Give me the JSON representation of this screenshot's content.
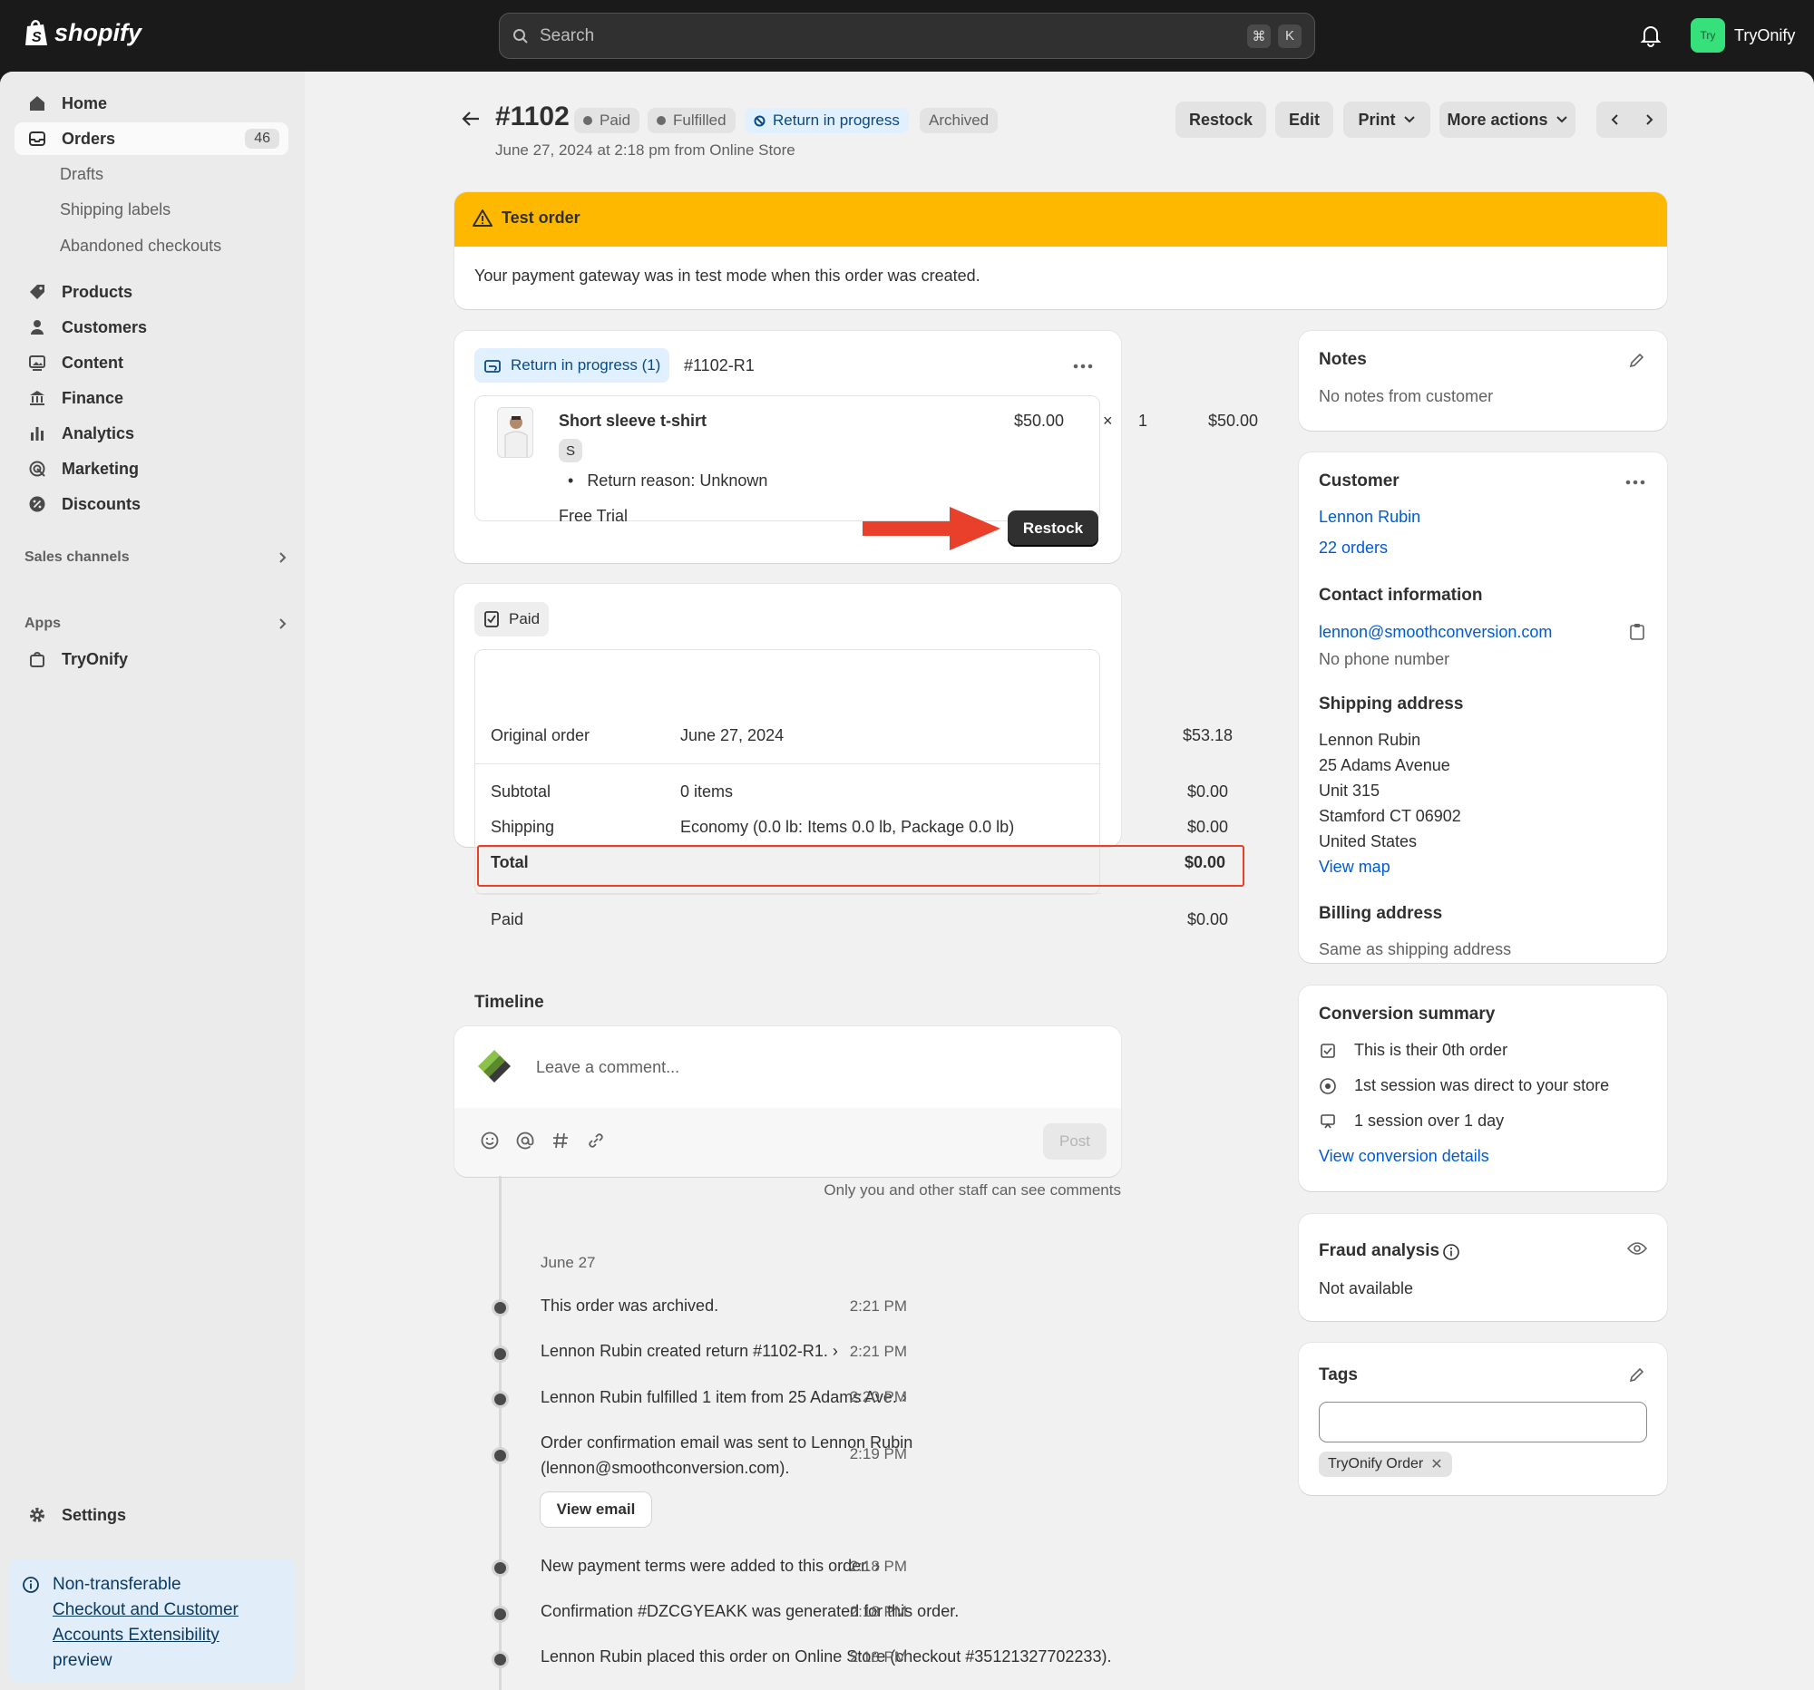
{
  "topbar": {
    "brand": "shopify",
    "search_placeholder": "Search",
    "kbd1": "⌘",
    "kbd2": "K",
    "store_avatar": "Try",
    "store_name": "TryOnify"
  },
  "sidebar": {
    "home": "Home",
    "orders": "Orders",
    "orders_count": "46",
    "drafts": "Drafts",
    "shipping_labels": "Shipping labels",
    "abandoned": "Abandoned checkouts",
    "products": "Products",
    "customers": "Customers",
    "content": "Content",
    "finance": "Finance",
    "analytics": "Analytics",
    "marketing": "Marketing",
    "discounts": "Discounts",
    "sales_channels": "Sales channels",
    "apps": "Apps",
    "tryonify": "TryOnify",
    "settings": "Settings",
    "promo_1": "Non-transferable",
    "promo_link": "Checkout and Customer Accounts Extensibility",
    "promo_2": "preview"
  },
  "header": {
    "order_number": "#1102",
    "badge_paid": "Paid",
    "badge_fulfilled": "Fulfilled",
    "badge_return": "Return in progress",
    "badge_archived": "Archived",
    "subtitle": "June 27, 2024 at 2:18 pm from Online Store",
    "btn_restock": "Restock",
    "btn_edit": "Edit",
    "btn_print": "Print",
    "btn_more": "More actions"
  },
  "alert": {
    "title": "Test order",
    "body": "Your payment gateway was in test mode when this order was created."
  },
  "return_card": {
    "badge": "Return in progress (1)",
    "ref": "#1102-R1",
    "item_name": "Short sleeve t-shirt",
    "variant": "S",
    "reason": "Return reason: Unknown",
    "note": "Free Trial",
    "price": "$50.00",
    "times": "×",
    "qty": "1",
    "total": "$50.00",
    "restock": "Restock"
  },
  "payment": {
    "badge": "Paid",
    "original_label": "Original order",
    "original_date": "June 27, 2024",
    "original_amount": "$53.18",
    "subtotal_label": "Subtotal",
    "subtotal_desc": "0 items",
    "subtotal_amount": "$0.00",
    "shipping_label": "Shipping",
    "shipping_desc": "Economy (0.0 lb: Items 0.0 lb, Package 0.0 lb)",
    "shipping_amount": "$0.00",
    "total_label": "Total",
    "total_amount": "$0.00",
    "paid_label": "Paid",
    "paid_amount": "$0.00"
  },
  "timeline": {
    "title": "Timeline",
    "placeholder": "Leave a comment...",
    "post": "Post",
    "staff_note": "Only you and other staff can see comments",
    "date": "June 27",
    "e1": "This order was archived.",
    "t1": "2:21 PM",
    "e2": "Lennon Rubin created return #1102-R1.",
    "t2": "2:21 PM",
    "e3": "Lennon Rubin fulfilled 1 item from 25 Adams Ave.",
    "t3": "2:20 PM",
    "e4a": "Order confirmation email was sent to Lennon Rubin",
    "e4b": "(lennon@smoothconversion.com).",
    "t4": "2:19 PM",
    "view_email": "View email",
    "e5": "New payment terms were added to this order.",
    "t5": "2:18 PM",
    "e6": "Confirmation #DZCGYEAKK was generated for this order.",
    "t6": "2:18 PM",
    "e7": "Lennon Rubin placed this order on Online Store (checkout #35121327702233).",
    "t7": "2:18 PM"
  },
  "notes": {
    "title": "Notes",
    "body": "No notes from customer"
  },
  "customer": {
    "title": "Customer",
    "name": "Lennon Rubin",
    "orders": "22 orders",
    "contact_title": "Contact information",
    "email": "lennon@smoothconversion.com",
    "phone": "No phone number",
    "ship_title": "Shipping address",
    "a1": "Lennon Rubin",
    "a2": "25 Adams Avenue",
    "a3": "Unit 315",
    "a4": "Stamford CT 06902",
    "a5": "United States",
    "view_map": "View map",
    "bill_title": "Billing address",
    "bill_body": "Same as shipping address"
  },
  "conversion": {
    "title": "Conversion summary",
    "l1": "This is their 0th order",
    "l2": "1st session was direct to your store",
    "l3": "1 session over 1 day",
    "link": "View conversion details"
  },
  "fraud": {
    "title": "Fraud analysis",
    "body": "Not available"
  },
  "tags": {
    "title": "Tags",
    "tag1": "TryOnify Order"
  },
  "colors": {
    "alert": "#ffb800",
    "link": "#005bd3",
    "annotation": "#e8402a"
  }
}
